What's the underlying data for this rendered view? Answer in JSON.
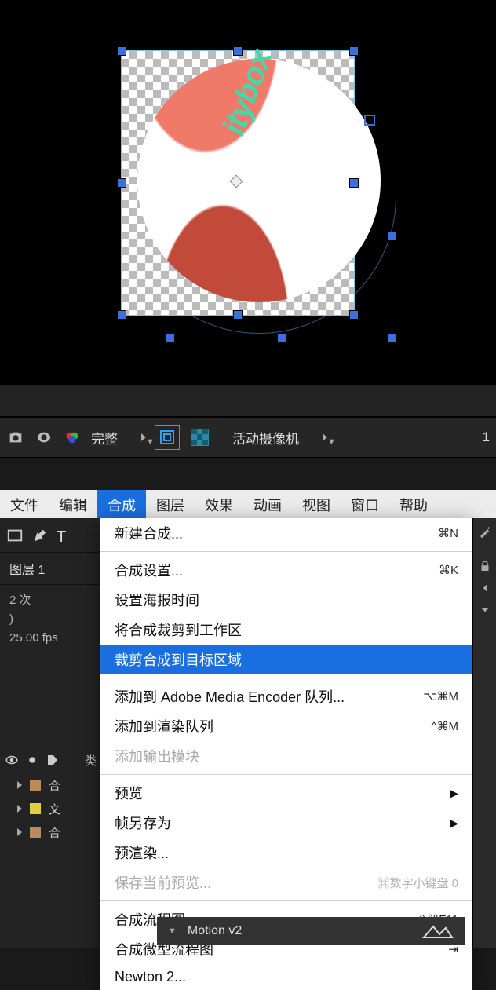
{
  "preview": {
    "ball_text": "itybox"
  },
  "viewport_toolbar": {
    "resolution": "完整",
    "camera": "活动摄像机",
    "trailing": "1"
  },
  "menubar": {
    "items": [
      {
        "label": "文件"
      },
      {
        "label": "编辑"
      },
      {
        "label": "合成"
      },
      {
        "label": "图层"
      },
      {
        "label": "效果"
      },
      {
        "label": "动画"
      },
      {
        "label": "视图"
      },
      {
        "label": "窗口"
      },
      {
        "label": "帮助"
      }
    ],
    "active_index": 2
  },
  "left_panel": {
    "tab": "图层 1",
    "meta_line1": "2 次",
    "meta_line2": ")",
    "meta_line3": "25.00 fps",
    "header_col": "类",
    "rows": [
      {
        "color": "#b98b5a",
        "label": "合"
      },
      {
        "color": "#e0d040",
        "label": "文"
      },
      {
        "color": "#b98b5a",
        "label": "合"
      }
    ]
  },
  "dropdown": {
    "groups": [
      [
        {
          "label": "新建合成...",
          "shortcut": "⌘N"
        }
      ],
      [
        {
          "label": "合成设置...",
          "shortcut": "⌘K"
        },
        {
          "label": "设置海报时间"
        },
        {
          "label": "将合成裁剪到工作区"
        },
        {
          "label": "裁剪合成到目标区域",
          "hover": true
        }
      ],
      [
        {
          "label": "添加到 Adobe Media Encoder 队列...",
          "shortcut": "⌥⌘M"
        },
        {
          "label": "添加到渲染队列",
          "shortcut": "^⌘M"
        },
        {
          "label": "添加输出模块",
          "disabled": true
        }
      ],
      [
        {
          "label": "预览",
          "submenu": true
        },
        {
          "label": "帧另存为",
          "submenu": true
        },
        {
          "label": "预渲染..."
        },
        {
          "label": "保存当前预览...",
          "shortcut": "⌘数字小键盘 0",
          "disabled": true
        }
      ],
      [
        {
          "label": "合成流程图",
          "shortcut": "⇧⌘F11"
        },
        {
          "label": "合成微型流程图",
          "shortcut": "⇥"
        },
        {
          "label": "Newton 2..."
        }
      ]
    ]
  },
  "bottom_strip": {
    "label": "Motion v2"
  }
}
